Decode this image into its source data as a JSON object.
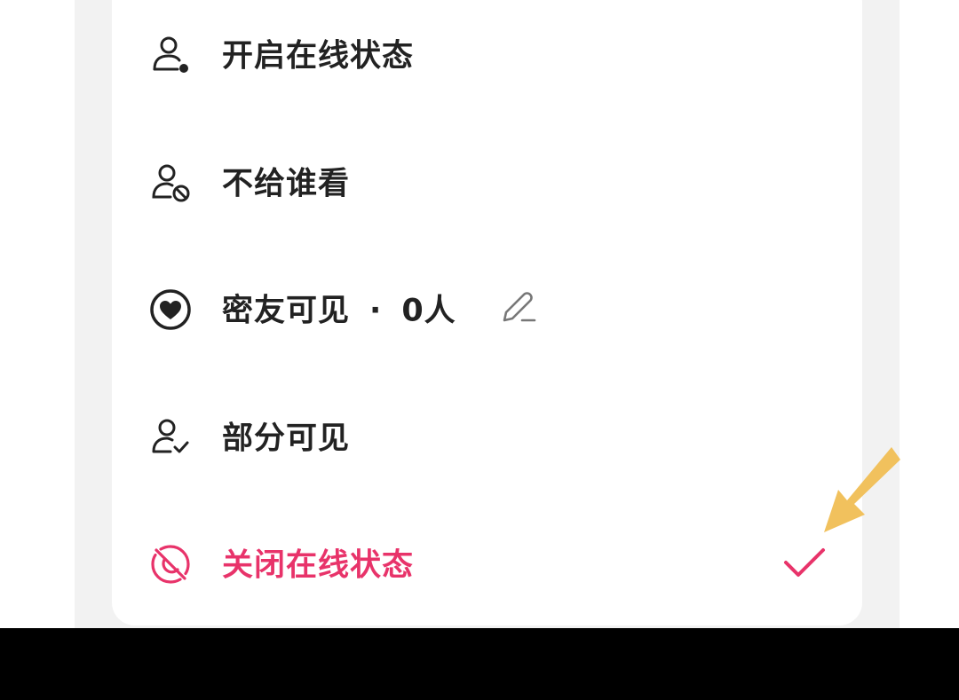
{
  "menu": {
    "items": [
      {
        "label": "开启在线状态",
        "icon": "user-dot-icon",
        "selected": false
      },
      {
        "label": "不给谁看",
        "icon": "user-block-icon",
        "selected": false
      },
      {
        "label": "密友可见",
        "icon": "heart-circle-icon",
        "selected": false,
        "separator": "·",
        "count_text": "0人",
        "edit_icon": "edit-pencil-icon"
      },
      {
        "label": "部分可见",
        "icon": "user-check-icon",
        "selected": false
      },
      {
        "label": "关闭在线状态",
        "icon": "eye-off-icon",
        "selected": true,
        "selected_icon": "checkmark-icon"
      }
    ]
  },
  "colors": {
    "text": "#222222",
    "accent": "#e8336a",
    "arrow": "#f1c15d",
    "panel_bg": "#f2f2f2",
    "card_bg": "#ffffff",
    "bottom_bar": "#000000"
  },
  "annotation": {
    "icon": "pointer-arrow-icon"
  }
}
